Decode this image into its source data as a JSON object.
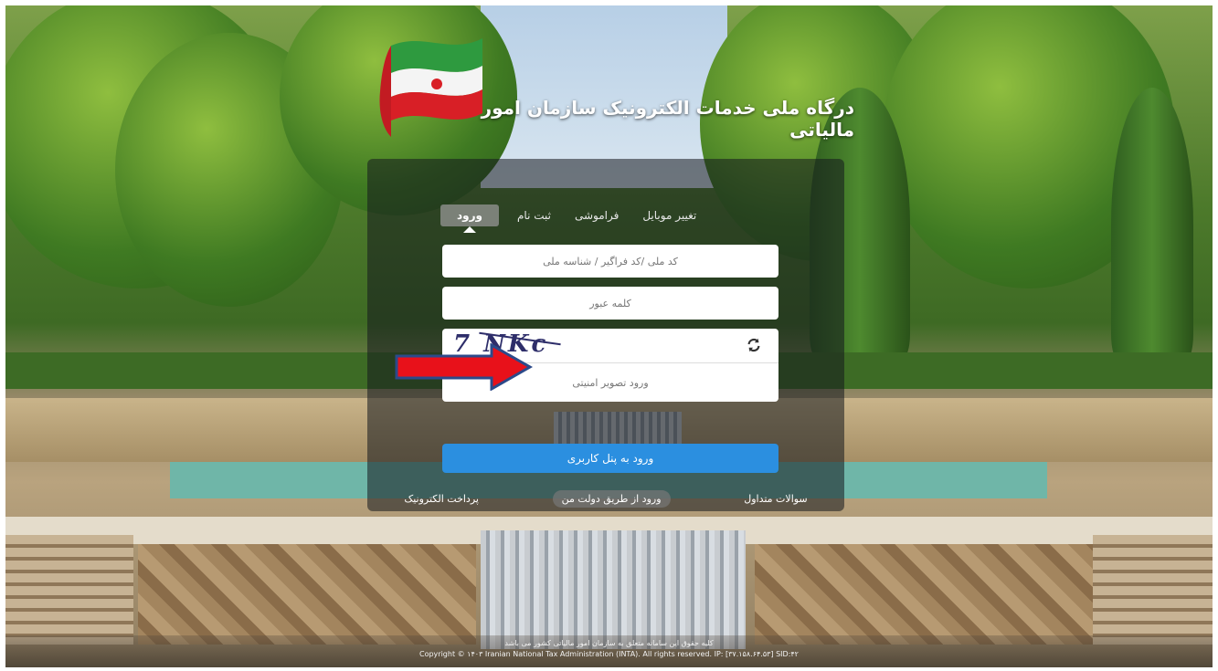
{
  "header": {
    "portal_title": "درگاه ملی خدمات الکترونیک سازمان امور مالیاتی"
  },
  "tabs": [
    {
      "label": "ورود",
      "active": true
    },
    {
      "label": "ثبت نام",
      "active": false
    },
    {
      "label": "فراموشی",
      "active": false
    },
    {
      "label": "تغییر موبایل",
      "active": false
    }
  ],
  "login": {
    "username_placeholder": "کد ملی /کد فراگیر / شناسه ملی",
    "password_placeholder": "کلمه عبور",
    "captcha_image_text": "7 NKc",
    "captcha_placeholder": "ورود تصویر امنیتی",
    "submit_label": "ورود به پنل کاربری"
  },
  "bottom_links": {
    "faq": "سوالات متداول",
    "gov_login": "ورود از طریق دولت من",
    "e_payment": "پرداخت الکترونیک"
  },
  "footer": {
    "rights_text": "کلیه حقوق این سامانه متعلق به سازمان امور مالیاتی کشور می باشد",
    "copyright": "Copyright © ۱۴۰۳ Iranian National Tax Administration (INTA). All rights reserved. IP: [۳۷.۱۵۸.۶۴.۵۳] SID:۴۲"
  },
  "colors": {
    "submit": "#2b8fe0",
    "annotation_arrow": "#e8111a",
    "annotation_arrow_border": "#2c4a8a"
  }
}
